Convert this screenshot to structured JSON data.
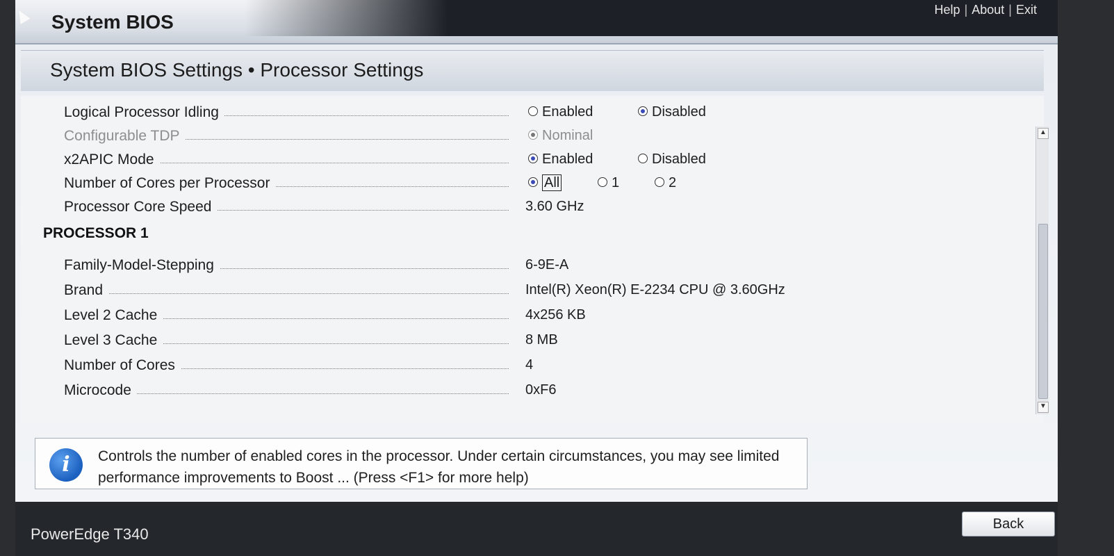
{
  "app": {
    "title": "System BIOS",
    "links": {
      "help": "Help",
      "about": "About",
      "exit": "Exit",
      "separator": "|"
    }
  },
  "page": {
    "title_main": "System BIOS Settings",
    "bullet": "•",
    "title_sub": "Processor Settings"
  },
  "settings": [
    {
      "label": "Logical Processor Idling",
      "options": [
        "Enabled",
        "Disabled"
      ],
      "selected": "Disabled"
    },
    {
      "label": "Configurable TDP",
      "options": [
        "Nominal"
      ],
      "selected": "Nominal",
      "disabled": true
    },
    {
      "label": "x2APIC Mode",
      "options": [
        "Enabled",
        "Disabled"
      ],
      "selected": "Enabled"
    },
    {
      "label": "Number of Cores per Processor",
      "options": [
        "All",
        "1",
        "2"
      ],
      "selected": "All"
    },
    {
      "label": "Processor Core Speed",
      "value": "3.60 GHz"
    }
  ],
  "processor": {
    "heading": "PROCESSOR 1",
    "rows": [
      {
        "label": "Family-Model-Stepping",
        "value": "6-9E-A"
      },
      {
        "label": "Brand",
        "value": "Intel(R) Xeon(R) E-2234 CPU @ 3.60GHz"
      },
      {
        "label": "Level 2 Cache",
        "value": "4x256 KB"
      },
      {
        "label": "Level 3 Cache",
        "value": "8 MB"
      },
      {
        "label": "Number of Cores",
        "value": "4"
      },
      {
        "label": "Microcode",
        "value": "0xF6"
      }
    ]
  },
  "help": {
    "text": "Controls the number of enabled cores in the processor. Under certain circumstances, you may see limited performance improvements to Boost ... (Press <F1> for more help)"
  },
  "footer": {
    "model": "PowerEdge T340",
    "back_label": "Back"
  },
  "icons": {
    "help": "info-icon",
    "scroll_up": "scroll-up-arrow-icon",
    "scroll_down": "scroll-down-arrow-icon",
    "pointer": "mouse-cursor-icon"
  },
  "colors": {
    "accent": "#3a4bb8",
    "header_dark": "#1d2127",
    "info_blue": "#1b5fbf"
  }
}
